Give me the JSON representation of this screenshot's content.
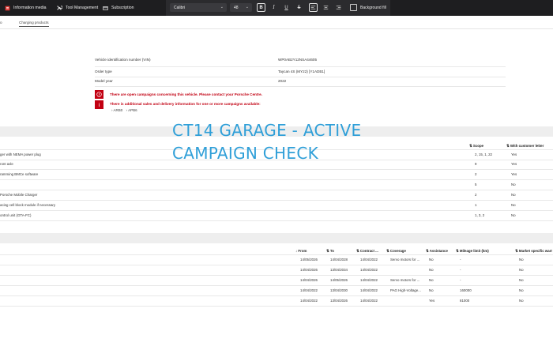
{
  "topbar": {
    "nav": [
      "Information media",
      "Tool Management",
      "Subscription"
    ],
    "font_name": "Calibri",
    "font_size": "48",
    "background_fill_label": "Background fill"
  },
  "tabs": [
    "o",
    "Charging products"
  ],
  "vehicle": {
    "vin_label": "Vehicle identification number (VIN)",
    "vin_value": "WP0AB2Y12NSA44605",
    "order_type_label": "Order type",
    "order_type_value": "Taycan 4S (MY22) [Y1ADB1]",
    "model_year_label": "Model year",
    "model_year_value": "2022"
  },
  "warnings": {
    "open_campaigns": "There are open campaigns concerning this vehicle. Please contact your Porsche Centre.",
    "additional_info": "There is additional sales and delivery information for one or more campaigns available:",
    "links": [
      "ARB0",
      "APB6"
    ]
  },
  "overlay": {
    "line1": "CT14 GARAGE - ACTIVE",
    "line2": "CAMPAIGN CHECK"
  },
  "campaigns": {
    "headers": {
      "scope": "Scope",
      "customer_letter": "With customer letter"
    },
    "rows": [
      {
        "desc": "ger with NEMA power plug",
        "scope": "2, 15, 1, 22",
        "letter": "Yes"
      },
      {
        "desc": "ront axle",
        "scope": "9",
        "letter": "Yes"
      },
      {
        "desc": "ramming BMCe software",
        "scope": "2",
        "letter": "Yes"
      },
      {
        "desc": "",
        "scope": "5",
        "letter": "No"
      },
      {
        "desc": "Porsche Mobile Charger",
        "scope": "2",
        "letter": "No"
      },
      {
        "desc": "acing cell block module if necessary",
        "scope": "1",
        "letter": "No"
      },
      {
        "desc": "ontrol unit (GTA-FC)",
        "scope": "1, 3, 2",
        "letter": "No"
      }
    ]
  },
  "contracts": {
    "headers": [
      "From",
      "To",
      "Contract ...",
      "Coverage",
      "Assistance",
      "Mileage limit (km)",
      "Market specific warr"
    ],
    "rows": [
      [
        "14/05/2026",
        "14/04/2028",
        "14/04/2022",
        "Servo motors for ...",
        "No",
        "-",
        "No"
      ],
      [
        "14/04/2026",
        "13/04/2034",
        "14/04/2022",
        "",
        "No",
        "-",
        "No"
      ],
      [
        "14/04/2026",
        "14/05/2026",
        "14/04/2022",
        "Servo motors for ...",
        "No",
        "-",
        "No"
      ],
      [
        "14/04/2022",
        "13/04/2030",
        "14/04/2022",
        "PAG High-Voltage...",
        "No",
        "160000",
        "No"
      ],
      [
        "14/04/2022",
        "13/04/2026",
        "14/04/2022",
        "",
        "Yes",
        "81000",
        "No"
      ]
    ]
  }
}
